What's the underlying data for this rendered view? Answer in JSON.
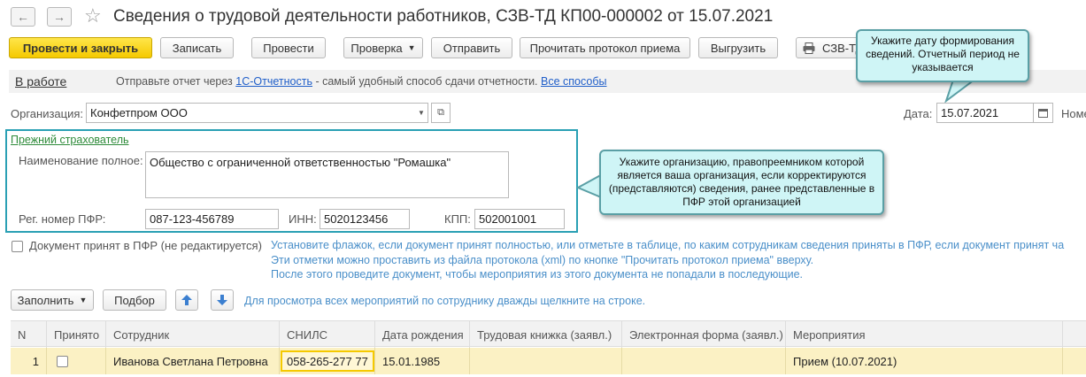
{
  "header": {
    "title": "Сведения о трудовой деятельности работников, СЗВ-ТД КП00-000002 от 15.07.2021"
  },
  "toolbar": {
    "post_close": "Провести и закрыть",
    "save": "Записать",
    "post": "Провести",
    "check": "Проверка",
    "send": "Отправить",
    "read_protocol": "Прочитать протокол приема",
    "export": "Выгрузить",
    "print_label": "СЗВ-ТД"
  },
  "status": {
    "state": "В работе",
    "text_before": "Отправьте отчет через",
    "service_link": "1С-Отчетность",
    "text_after": "- самый удобный способ сдачи отчетности.",
    "all_ways": "Все способы"
  },
  "org": {
    "label": "Организация:",
    "value": "Конфетпром ООО",
    "date_label": "Дата:",
    "date_value": "15.07.2021",
    "number_label": "Номе"
  },
  "prev_insurer": {
    "link": "Прежний страхователь",
    "name_label": "Наименование полное:",
    "name_value": "Общество с ограниченной ответственностью \"Ромашка\"",
    "pfr_label": "Рег. номер ПФР:",
    "pfr_value": "087-123-456789",
    "inn_label": "ИНН:",
    "inn_value": "5020123456",
    "kpp_label": "КПП:",
    "kpp_value": "502001001"
  },
  "tips": {
    "date_tip": "Укажите дату формирования сведений.  Отчетный период не указывается",
    "org_tip": "Укажите организацию, правопреемником которой является ваша организация, если корректируются (представляются) сведения, ранее представленные в ПФР этой организацией"
  },
  "accepted": {
    "label": "Документ принят в ПФР (не редактируется)",
    "note1": "Установите флажок, если документ принят полностью, или отметьте в таблице, по каким сотрудникам сведения приняты в ПФР, если документ принят ча",
    "note2": "Эти отметки можно проставить из файла протокола (xml) по кнопке \"Прочитать протокол приема\" вверху.",
    "note3": "После этого проведите документ, чтобы мероприятия из этого документа не попадали в последующие."
  },
  "table_toolbar": {
    "fill": "Заполнить",
    "select": "Подбор",
    "hint": "Для просмотра всех мероприятий по сотруднику дважды щелкните на строке."
  },
  "table": {
    "columns": [
      "N",
      "Принято",
      "Сотрудник",
      "СНИЛС",
      "Дата рождения",
      "Трудовая книжка (заявл.)",
      "Электронная форма (заявл.)",
      "Мероприятия"
    ],
    "rows": [
      {
        "n": "1",
        "accepted": "",
        "employee": "Иванова Светлана Петровна",
        "snils": "058-265-277 77",
        "birth": "15.01.1985",
        "book": "",
        "eform": "",
        "events": "Прием (10.07.2021)"
      }
    ]
  },
  "colors": {
    "accent_yellow": "#f5c900",
    "tip_bg": "#cff5f6",
    "frame": "#2aa0b4",
    "row_highlight": "#fbf1c4"
  }
}
